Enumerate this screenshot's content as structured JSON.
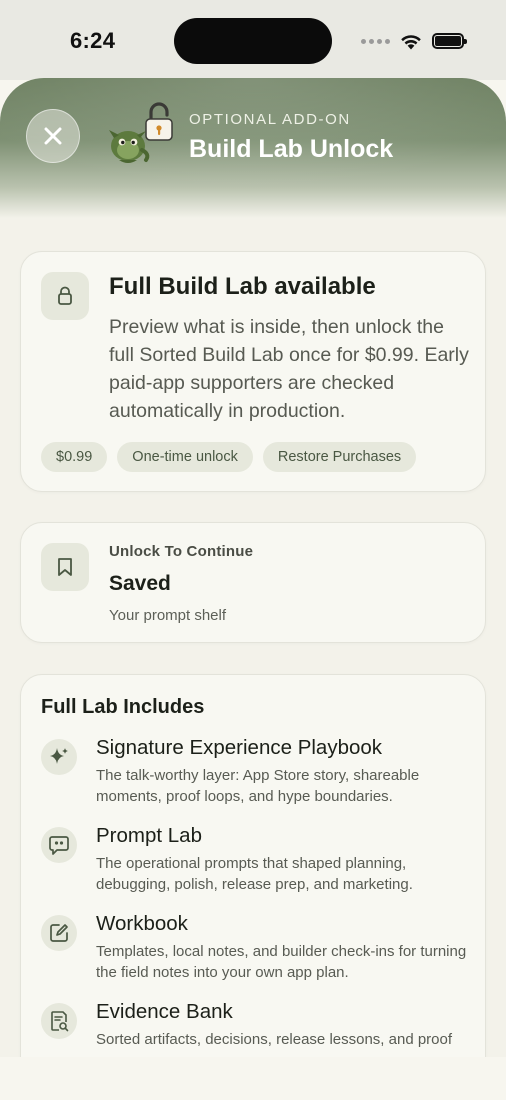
{
  "status_bar": {
    "time": "6:24"
  },
  "header": {
    "eyebrow": "OPTIONAL ADD-ON",
    "title": "Build Lab Unlock"
  },
  "icons": {
    "close": "close-icon",
    "mascot": "mascot-lock-icon",
    "lock": "lock-icon",
    "bookmark": "bookmark-icon",
    "sparkle": "sparkle-icon",
    "chat": "quote-bubble-icon",
    "edit": "edit-square-icon",
    "evidence": "document-search-icon"
  },
  "availability_card": {
    "title": "Full Build Lab available",
    "body": "Preview what is inside, then unlock the full Sorted Build Lab once for $0.99. Early paid-app supporters are checked automatically in production.",
    "chips": [
      "$0.99",
      "One-time unlock",
      "Restore Purchases"
    ]
  },
  "locked_card": {
    "eyebrow": "Unlock To Continue",
    "title": "Saved",
    "subtitle": "Your prompt shelf"
  },
  "includes": {
    "title": "Full Lab Includes",
    "items": [
      {
        "title": "Signature Experience Playbook",
        "desc": "The talk-worthy layer: App Store story, shareable moments, proof loops, and hype boundaries."
      },
      {
        "title": "Prompt Lab",
        "desc": "The operational prompts that shaped planning, debugging, polish, release prep, and marketing."
      },
      {
        "title": "Workbook",
        "desc": "Templates, local notes, and builder check-ins for turning the field notes into your own app plan."
      },
      {
        "title": "Evidence Bank",
        "desc": "Sorted artifacts, decisions, release lessons, and proof"
      }
    ]
  },
  "colors": {
    "accent": "#4a5843",
    "header_green": "#6c7f60",
    "background": "#f3f2ea",
    "chip": "#e6e8dc"
  }
}
